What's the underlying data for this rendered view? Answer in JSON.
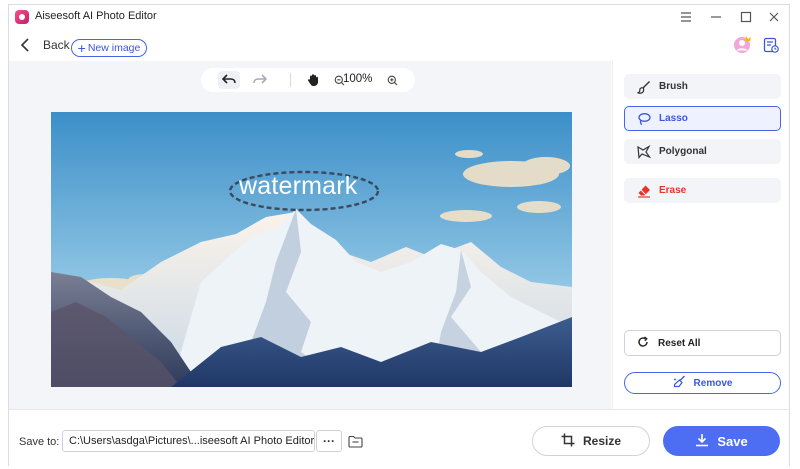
{
  "window": {
    "title": "Aiseesoft AI Photo Editor",
    "controls": [
      "menu-icon",
      "minimize-icon",
      "maximize-icon",
      "close-icon"
    ]
  },
  "nav": {
    "back_label": "Back",
    "new_image_label": "New image",
    "icons": [
      "chevron-left-icon",
      "plus-icon",
      "avatar-icon",
      "task-list-icon"
    ]
  },
  "canvas": {
    "toolbar": {
      "zoom_level": "100%",
      "icons": [
        "undo-icon",
        "redo-icon",
        "hand-icon",
        "zoom-out-icon",
        "zoom-in-icon"
      ]
    },
    "image_text": "watermark"
  },
  "tools": {
    "brush": "Brush",
    "lasso": "Lasso",
    "polygonal": "Polygonal",
    "erase": "Erase",
    "selected": "Lasso",
    "reset_all": "Reset All",
    "remove": "Remove"
  },
  "bottom": {
    "save_to_label": "Save to:",
    "save_path": "C:\\Users\\asdga\\Pictures\\...iseesoft AI Photo Editor",
    "more_label": "···",
    "resize_label": "Resize",
    "save_label": "Save"
  },
  "colors": {
    "accent": "#4d6ef2",
    "accent_text": "#3b56e0",
    "erase": "#e6352c",
    "canvas_bg": "#f4f5f8"
  }
}
